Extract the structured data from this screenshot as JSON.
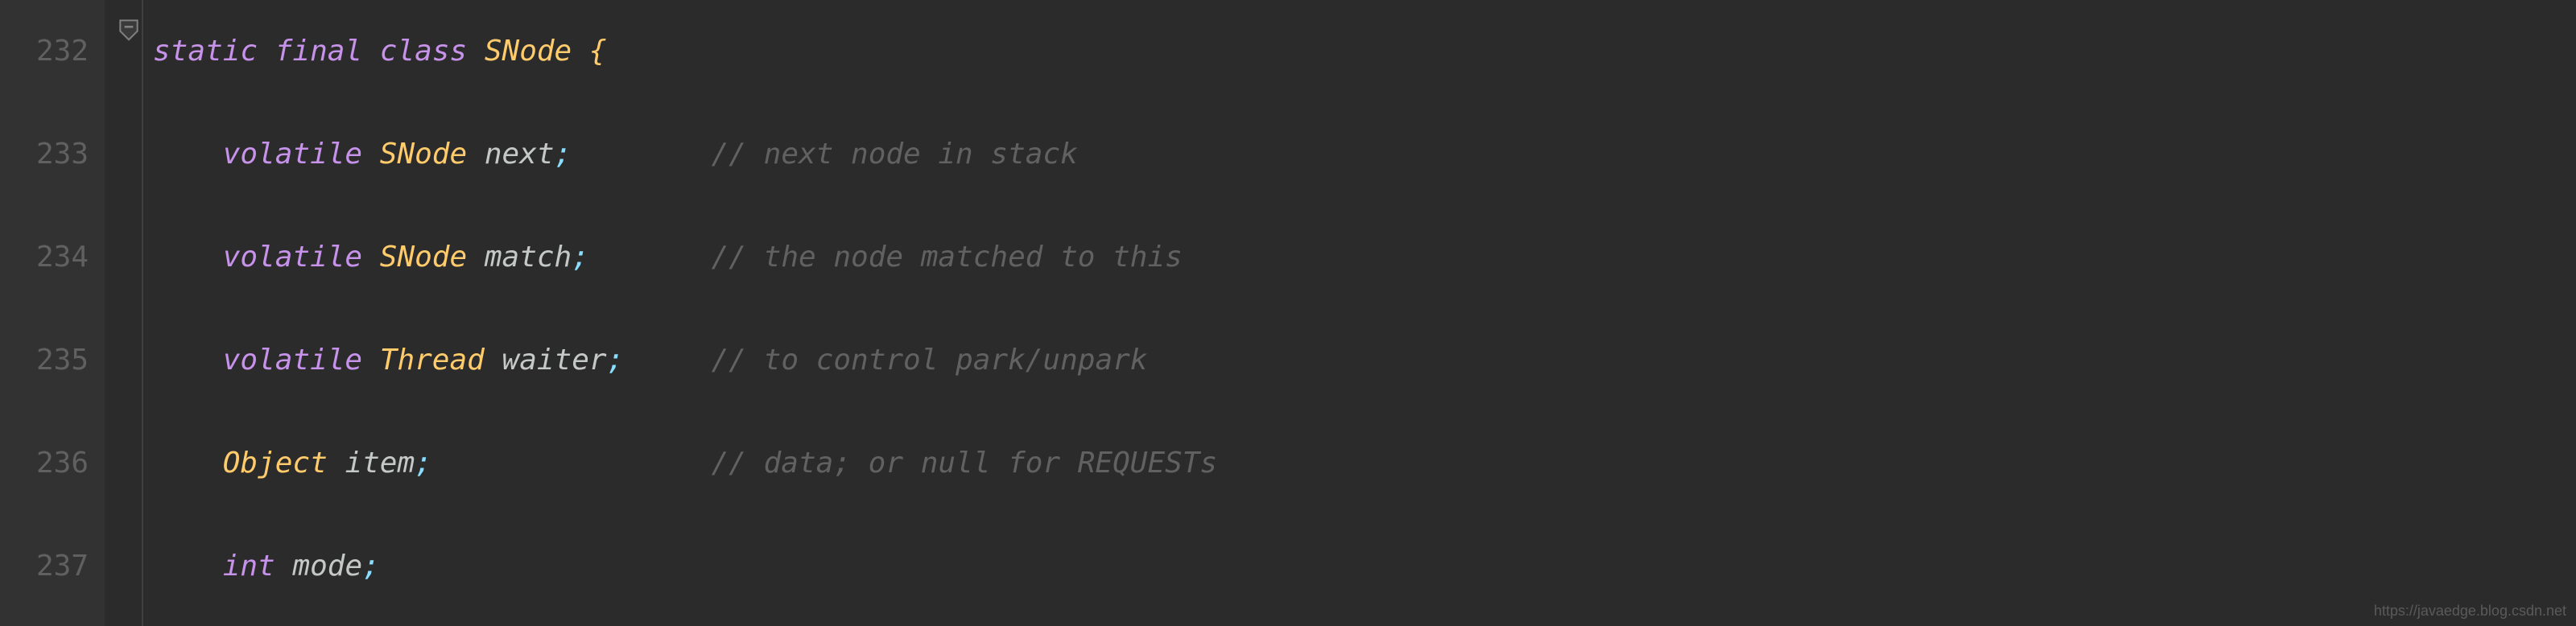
{
  "gutter": {
    "lines": [
      "232",
      "233",
      "234",
      "235",
      "236",
      "237"
    ]
  },
  "code": {
    "line1": {
      "kw_static": "static",
      "kw_final": "final",
      "kw_class": "class",
      "type": "SNode",
      "brace": "{"
    },
    "line2": {
      "kw_volatile": "volatile",
      "type": "SNode",
      "ident": "next",
      "semi": ";",
      "comment": "// next node in stack"
    },
    "line3": {
      "kw_volatile": "volatile",
      "type": "SNode",
      "ident": "match",
      "semi": ";",
      "comment": "// the node matched to this"
    },
    "line4": {
      "kw_volatile": "volatile",
      "type": "Thread",
      "ident": "waiter",
      "semi": ";",
      "comment": "// to control park/unpark"
    },
    "line5": {
      "type": "Object",
      "ident": "item",
      "semi": ";",
      "comment": "// data; or null for REQUESTs"
    },
    "line6": {
      "kw_int": "int",
      "ident": "mode",
      "semi": ";"
    }
  },
  "watermark": "https://javaedge.blog.csdn.net"
}
